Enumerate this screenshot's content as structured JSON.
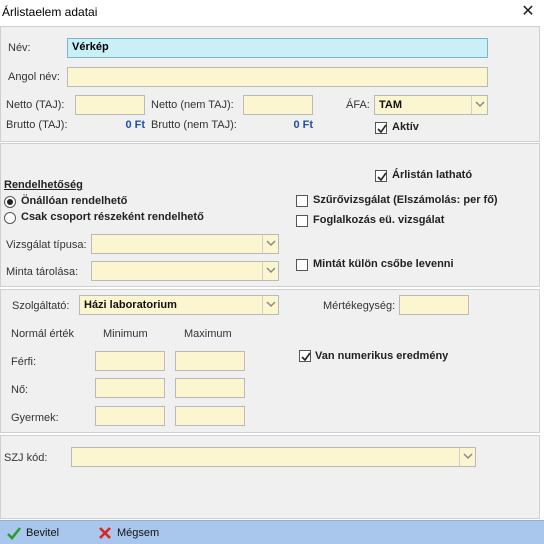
{
  "window": {
    "title": "Árlistaelem adatai"
  },
  "general": {
    "name_label": "Név:",
    "name_value": "Vérkép",
    "english_name_label": "Angol név:",
    "english_name_value": "",
    "net_taj_label": "Netto (TAJ):",
    "net_taj_value": "",
    "net_nontaj_label": "Netto (nem TAJ):",
    "net_nontaj_value": "",
    "vat_label": "ÁFA:",
    "vat_value": "TAM",
    "gross_taj_label": "Brutto (TAJ):",
    "gross_taj_value": "0 Ft",
    "gross_nontaj_label": "Brutto (nem TAJ):",
    "gross_nontaj_value": "0 Ft",
    "active_label": "Aktív",
    "active_checked": true
  },
  "ordering": {
    "section_title": "Rendelhetőség",
    "on_pricelist_label": "Árlistán latható",
    "on_pricelist_checked": true,
    "radio_standalone": "Önállóan rendelhető",
    "radio_group": "Csak csoport részeként rendelhető",
    "selected_radio": "standalone",
    "screening_label": "Szűrővizsgálat (Elszámolás: per fő)",
    "screening_checked": false,
    "occupational_label": "Foglalkozás eü. vizsgálat",
    "occupational_checked": false,
    "exam_type_label": "Vizsgálat típusa:",
    "exam_type_value": "",
    "sample_storage_label": "Minta tárolása:",
    "sample_storage_value": "",
    "separate_tube_label": "Mintát külön csőbe levenni",
    "separate_tube_checked": false
  },
  "service": {
    "provider_label": "Szolgáltató:",
    "provider_value": "Házi laboratorium",
    "unit_label": "Mértékegység:",
    "unit_value": "",
    "normal_value_label": "Normál érték",
    "min_label": "Minimum",
    "max_label": "Maximum",
    "numeric_result_label": "Van numerikus eredmény",
    "numeric_result_checked": true,
    "rows": [
      {
        "label": "Férfi:",
        "min": "",
        "max": ""
      },
      {
        "label": "Nő:",
        "min": "",
        "max": ""
      },
      {
        "label": "Gyermek:",
        "min": "",
        "max": ""
      }
    ]
  },
  "szj": {
    "label": "SZJ kód:",
    "value": ""
  },
  "footer": {
    "ok_label": "Bevitel",
    "cancel_label": "Mégsem"
  },
  "colors": {
    "input_bg": "#fbf6d0",
    "focus_bg": "#c8f0f6",
    "footer_bg": "#a9c7ec",
    "money": "#1f4fa8"
  }
}
